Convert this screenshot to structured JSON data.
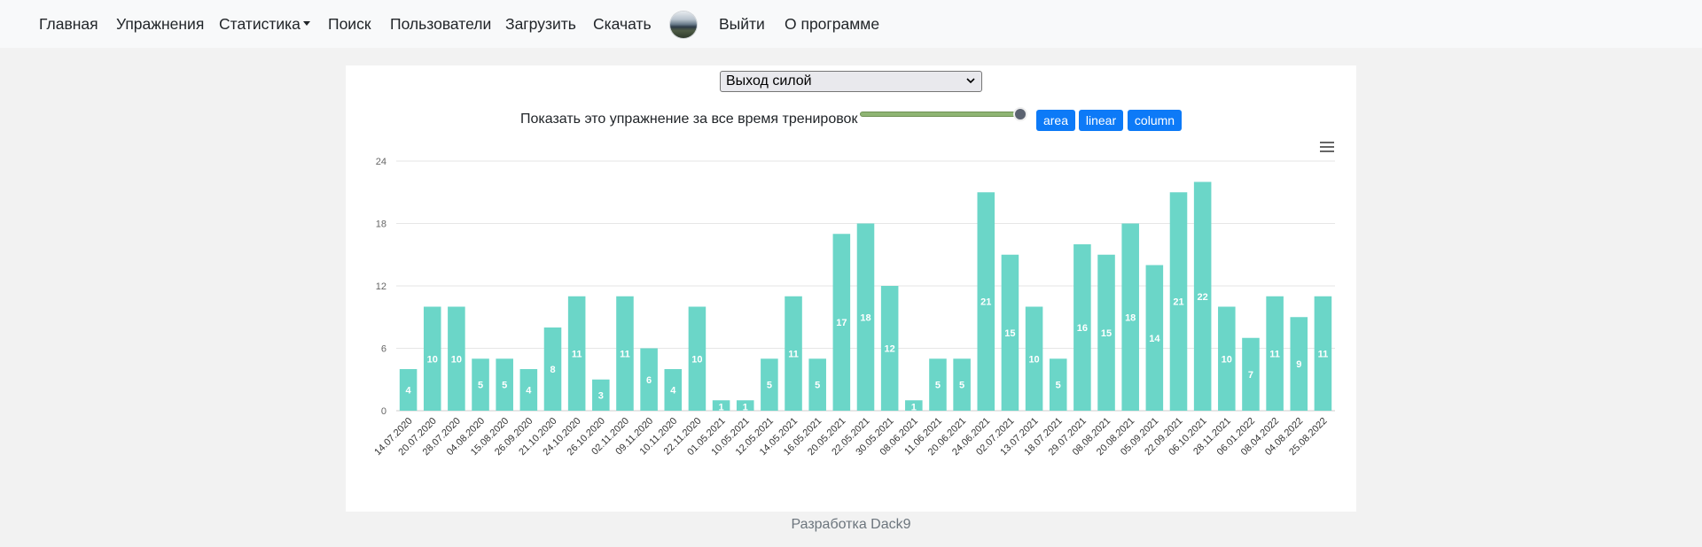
{
  "nav": {
    "items": [
      {
        "label": "Главная",
        "caret": false
      },
      {
        "label": "Упражнения",
        "caret": false
      },
      {
        "label": "Статистика",
        "caret": true
      },
      {
        "label": "Поиск",
        "caret": false
      },
      {
        "label": "Пользователи",
        "caret": false
      },
      {
        "label": "Загрузить",
        "caret": false
      },
      {
        "label": "Скачать",
        "caret": false
      },
      {
        "label": "Выйти",
        "caret": false
      },
      {
        "label": "О программе",
        "caret": false
      }
    ],
    "avatar_icon": "avatar-image"
  },
  "controls": {
    "exercise_select": "Выход силой",
    "show_all_label": "Показать это упражнение за все время тренировок",
    "slider_value": 1.0,
    "buttons": {
      "area": "area",
      "linear": "linear",
      "column": "column"
    },
    "button_color": "#0d7af7",
    "menu_icon": "hamburger-menu-icon"
  },
  "chart_data": {
    "type": "bar",
    "color": "#6bd6c8",
    "ylim": [
      0,
      24
    ],
    "yticks": [
      0,
      6,
      12,
      18,
      24
    ],
    "grid": true,
    "data_labels": true,
    "categories": [
      "14.07.2020",
      "20.07.2020",
      "28.07.2020",
      "04.08.2020",
      "15.08.2020",
      "26.09.2020",
      "21.10.2020",
      "24.10.2020",
      "26.10.2020",
      "02.11.2020",
      "09.11.2020",
      "10.11.2020",
      "22.11.2020",
      "01.05.2021",
      "10.05.2021",
      "12.05.2021",
      "14.05.2021",
      "16.05.2021",
      "20.05.2021",
      "22.05.2021",
      "30.05.2021",
      "08.06.2021",
      "11.06.2021",
      "20.06.2021",
      "24.06.2021",
      "02.07.2021",
      "13.07.2021",
      "18.07.2021",
      "29.07.2021",
      "08.08.2021",
      "20.08.2021",
      "05.09.2021",
      "22.09.2021",
      "06.10.2021",
      "28.11.2021",
      "06.01.2022",
      "08.04.2022",
      "04.08.2022",
      "25.08.2022"
    ],
    "values": [
      4,
      10,
      10,
      5,
      5,
      4,
      8,
      11,
      3,
      11,
      6,
      4,
      10,
      1,
      1,
      5,
      11,
      5,
      17,
      18,
      12,
      1,
      5,
      5,
      21,
      15,
      10,
      5,
      16,
      15,
      18,
      14,
      21,
      22,
      10,
      7,
      11,
      9,
      11
    ]
  },
  "footer": {
    "text": "Разработка Dack9"
  }
}
